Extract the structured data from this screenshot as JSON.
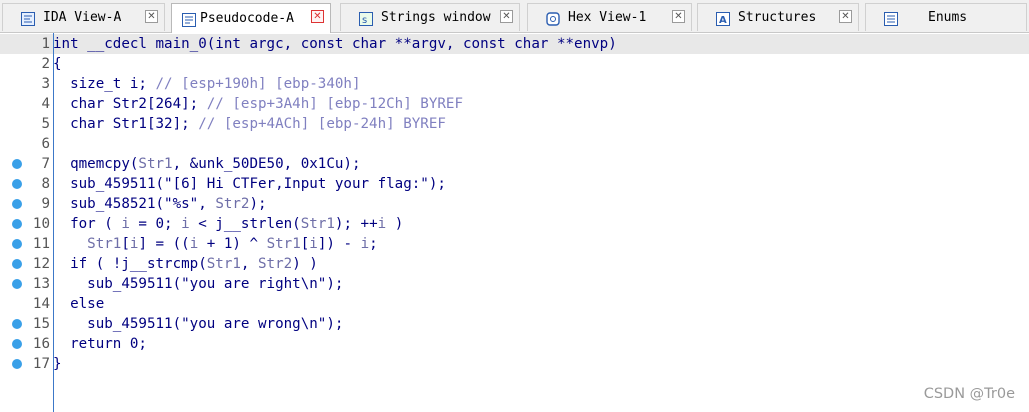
{
  "tabs": [
    {
      "label": "IDA View-A",
      "icon": "disassembly-icon",
      "active": false
    },
    {
      "label": "Pseudocode-A",
      "icon": "pseudocode-icon",
      "active": true
    },
    {
      "label": "Strings window",
      "icon": "strings-icon",
      "active": false
    },
    {
      "label": "Hex View-1",
      "icon": "hex-icon",
      "active": false
    },
    {
      "label": "Structures",
      "icon": "structures-icon",
      "active": false
    },
    {
      "label": "Enums",
      "icon": "enums-icon",
      "active": false
    }
  ],
  "code": [
    {
      "n": "1",
      "bp": false,
      "parts": [
        [
          "v",
          "int __cdecl main_0(int argc, const char **argv, const char **envp)"
        ]
      ]
    },
    {
      "n": "2",
      "bp": false,
      "parts": [
        [
          "v",
          "{"
        ]
      ]
    },
    {
      "n": "3",
      "bp": false,
      "parts": [
        [
          "v",
          "  size_t i; "
        ],
        [
          "cm",
          "// [esp+190h] [ebp-340h]"
        ]
      ]
    },
    {
      "n": "4",
      "bp": false,
      "parts": [
        [
          "v",
          "  char Str2[264]; "
        ],
        [
          "cm",
          "// [esp+3A4h] [ebp-12Ch] BYREF"
        ]
      ]
    },
    {
      "n": "5",
      "bp": false,
      "parts": [
        [
          "v",
          "  char Str1[32]; "
        ],
        [
          "cm",
          "// [esp+4ACh] [ebp-24h] BYREF"
        ]
      ]
    },
    {
      "n": "6",
      "bp": false,
      "parts": [
        [
          "v",
          ""
        ]
      ]
    },
    {
      "n": "7",
      "bp": true,
      "parts": [
        [
          "v",
          "  qmemcpy("
        ],
        [
          "var",
          "Str1"
        ],
        [
          "v",
          ", &unk_50DE50, 0x1Cu);"
        ]
      ]
    },
    {
      "n": "8",
      "bp": true,
      "parts": [
        [
          "v",
          "  sub_459511("
        ],
        [
          "str",
          "\"[6] Hi CTFer,Input your flag:\""
        ],
        [
          "v",
          ");"
        ]
      ]
    },
    {
      "n": "9",
      "bp": true,
      "parts": [
        [
          "v",
          "  sub_458521("
        ],
        [
          "str",
          "\"%s\""
        ],
        [
          "v",
          ", "
        ],
        [
          "var",
          "Str2"
        ],
        [
          "v",
          ");"
        ]
      ]
    },
    {
      "n": "10",
      "bp": true,
      "parts": [
        [
          "v",
          "  for ( "
        ],
        [
          "var",
          "i"
        ],
        [
          "v",
          " = 0; "
        ],
        [
          "var",
          "i"
        ],
        [
          "v",
          " < j__strlen("
        ],
        [
          "var",
          "Str1"
        ],
        [
          "v",
          "); ++"
        ],
        [
          "var",
          "i"
        ],
        [
          "v",
          " )"
        ]
      ]
    },
    {
      "n": "11",
      "bp": true,
      "parts": [
        [
          "v",
          "    "
        ],
        [
          "var",
          "Str1"
        ],
        [
          "v",
          "["
        ],
        [
          "var",
          "i"
        ],
        [
          "v",
          "] = (("
        ],
        [
          "var",
          "i"
        ],
        [
          "v",
          " + 1) ^ "
        ],
        [
          "var",
          "Str1"
        ],
        [
          "v",
          "["
        ],
        [
          "var",
          "i"
        ],
        [
          "v",
          "]) - "
        ],
        [
          "var",
          "i"
        ],
        [
          "v",
          ";"
        ]
      ]
    },
    {
      "n": "12",
      "bp": true,
      "parts": [
        [
          "v",
          "  if ( !j__strcmp("
        ],
        [
          "var",
          "Str1"
        ],
        [
          "v",
          ", "
        ],
        [
          "var",
          "Str2"
        ],
        [
          "v",
          ") )"
        ]
      ]
    },
    {
      "n": "13",
      "bp": true,
      "parts": [
        [
          "v",
          "    sub_459511("
        ],
        [
          "str",
          "\"you are right\\n\""
        ],
        [
          "v",
          ");"
        ]
      ]
    },
    {
      "n": "14",
      "bp": false,
      "parts": [
        [
          "v",
          "  else"
        ]
      ]
    },
    {
      "n": "15",
      "bp": true,
      "parts": [
        [
          "v",
          "    sub_459511("
        ],
        [
          "str",
          "\"you are wrong\\n\""
        ],
        [
          "v",
          ");"
        ]
      ]
    },
    {
      "n": "16",
      "bp": true,
      "parts": [
        [
          "v",
          "  return 0;"
        ]
      ]
    },
    {
      "n": "17",
      "bp": true,
      "parts": [
        [
          "v",
          "}"
        ]
      ]
    }
  ],
  "watermark": "CSDN @Tr0e",
  "colors": {
    "keyword": "#000080",
    "variable": "#6e6ea8",
    "comment": "#8080c0",
    "breakpoint": "#3aa0e8",
    "active_close": "#d33333"
  }
}
